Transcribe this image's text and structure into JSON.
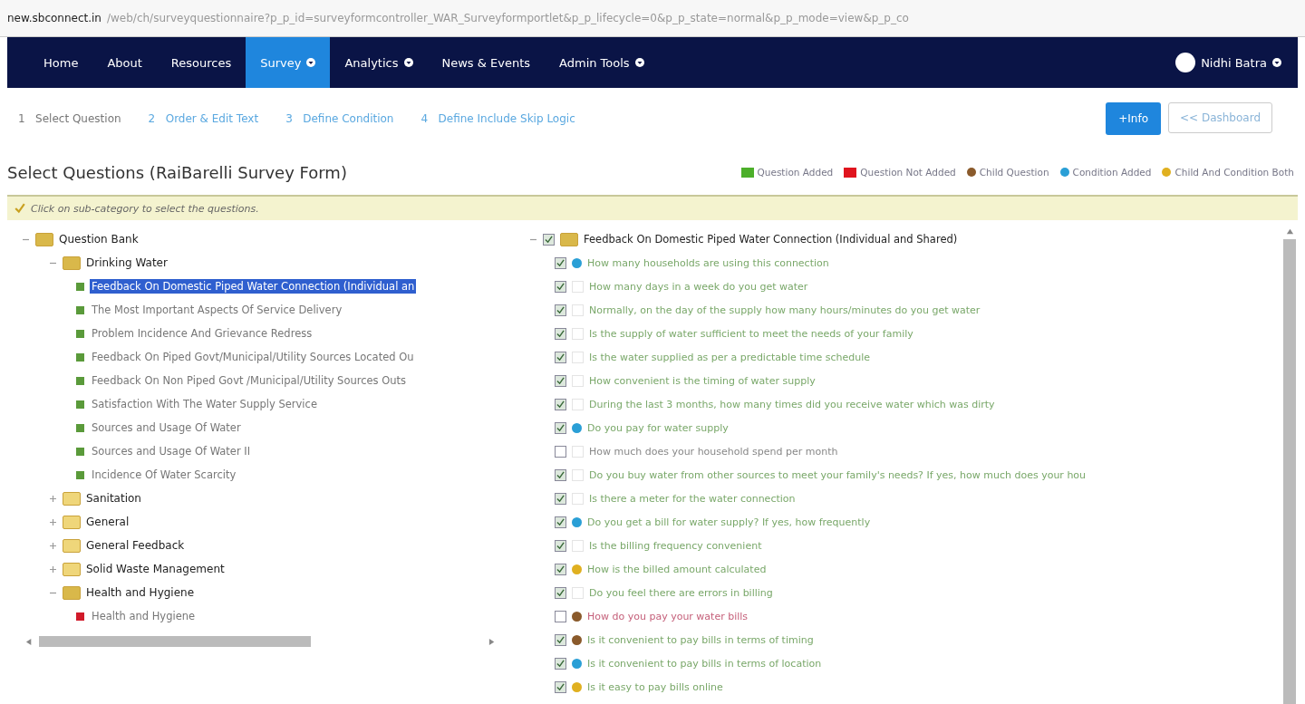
{
  "address_bar": {
    "domain": "new.sbconnect.in",
    "path": "/web/ch/surveyquestionnaire?p_p_id=surveyformcontroller_WAR_Surveyformportlet&p_p_lifecycle=0&p_p_state=normal&p_p_mode=view&p_p_co"
  },
  "nav": {
    "items": [
      {
        "label": "Home",
        "selected": false,
        "dropdown": false
      },
      {
        "label": "About",
        "selected": false,
        "dropdown": false
      },
      {
        "label": "Resources",
        "selected": false,
        "dropdown": false
      },
      {
        "label": "Survey",
        "selected": true,
        "dropdown": true
      },
      {
        "label": "Analytics",
        "selected": false,
        "dropdown": true
      },
      {
        "label": "News & Events",
        "selected": false,
        "dropdown": false
      },
      {
        "label": "Admin Tools",
        "selected": false,
        "dropdown": true
      }
    ],
    "user": "Nidhi Batra"
  },
  "steps": [
    {
      "number": "1",
      "label": "Select Question",
      "selected": true
    },
    {
      "number": "2",
      "label": "Order & Edit Text",
      "selected": false
    },
    {
      "number": "3",
      "label": "Define Condition",
      "selected": false
    },
    {
      "number": "4",
      "label": "Define Include Skip Logic",
      "selected": false
    }
  ],
  "buttons": {
    "info": "+Info",
    "dashboard": "<< Dashboard"
  },
  "title": "Select Questions (RaiBarelli Survey Form)",
  "legend": [
    {
      "kind": "square",
      "label": "Question Added",
      "color": "#4caf2a"
    },
    {
      "kind": "square",
      "label": "Question Not Added",
      "color": "#e0141e"
    },
    {
      "kind": "dot",
      "label": "Child Question",
      "color": "#8a5a2b"
    },
    {
      "kind": "dot",
      "label": "Condition Added",
      "color": "#2a9fd6"
    },
    {
      "kind": "dot",
      "label": "Child And Condition Both",
      "color": "#e0b020"
    }
  ],
  "hint": "Click on sub-category to select the questions.",
  "tree": [
    {
      "label": "Question Bank",
      "expanded": true,
      "children": [
        {
          "label": "Drinking Water",
          "expanded": true,
          "children": [
            {
              "label": "Feedback On Domestic Piped Water Connection (Individual an",
              "color": "#5a9a3a",
              "selected": true
            },
            {
              "label": "The Most Important Aspects Of Service Delivery",
              "color": "#5a9a3a",
              "selected": false
            },
            {
              "label": "Problem Incidence And Grievance Redress",
              "color": "#5a9a3a",
              "selected": false
            },
            {
              "label": "Feedback On Piped Govt/Municipal/Utility Sources Located Ou",
              "color": "#5a9a3a",
              "selected": false
            },
            {
              "label": "Feedback On Non Piped Govt /Municipal/Utility Sources Outs",
              "color": "#5a9a3a",
              "selected": false
            },
            {
              "label": "Satisfaction With The Water Supply Service",
              "color": "#5a9a3a",
              "selected": false
            },
            {
              "label": "Sources and Usage Of Water",
              "color": "#5a9a3a",
              "selected": false
            },
            {
              "label": "Sources and Usage Of Water II",
              "color": "#5a9a3a",
              "selected": false
            },
            {
              "label": "Incidence Of Water Scarcity",
              "color": "#5a9a3a",
              "selected": false
            }
          ]
        },
        {
          "label": "Sanitation",
          "expanded": false
        },
        {
          "label": "General",
          "expanded": false
        },
        {
          "label": "General Feedback",
          "expanded": false
        },
        {
          "label": "Solid Waste Management",
          "expanded": false
        },
        {
          "label": "Health and Hygiene",
          "expanded": true,
          "children": [
            {
              "label": "Health and Hygiene",
              "color": "#d11a2a",
              "selected": false
            }
          ]
        }
      ]
    }
  ],
  "questions": {
    "title": "Feedback On Domestic Piped Water Connection (Individual and Shared)",
    "expanded": true,
    "checked": true,
    "items": [
      {
        "text": "How many households are using this connection",
        "checked": true,
        "marker": {
          "color": "#2a9fd6"
        },
        "color": "#7aa86a"
      },
      {
        "text": "How many days in a week do you get water",
        "checked": true,
        "color": "#7aa86a"
      },
      {
        "text": "Normally, on the day of the supply how many hours/minutes do you get water",
        "checked": true,
        "color": "#7aa86a"
      },
      {
        "text": "Is the supply of water sufficient to meet the needs of your family",
        "checked": true,
        "color": "#7aa86a"
      },
      {
        "text": "Is the water supplied as per a predictable time schedule",
        "checked": true,
        "color": "#7aa86a"
      },
      {
        "text": "How convenient is the timing of water supply",
        "checked": true,
        "color": "#7aa86a"
      },
      {
        "text": "During the last 3 months, how many times did you receive water which was dirty",
        "checked": true,
        "color": "#7aa86a"
      },
      {
        "text": "Do you pay for water supply",
        "checked": true,
        "marker": {
          "color": "#2a9fd6"
        },
        "color": "#7aa86a"
      },
      {
        "text": "How much does your household spend per month",
        "checked": false,
        "color": "#888888"
      },
      {
        "text": "Do you buy water from other sources to meet your family's needs? If yes, how much does your hou",
        "checked": true,
        "color": "#7aa86a"
      },
      {
        "text": "Is there a meter for the water connection",
        "checked": true,
        "color": "#7aa86a"
      },
      {
        "text": "Do you get a bill for water supply? If yes, how frequently",
        "checked": true,
        "marker": {
          "color": "#2a9fd6"
        },
        "color": "#7aa86a"
      },
      {
        "text": "Is the billing frequency convenient",
        "checked": true,
        "color": "#7aa86a"
      },
      {
        "text": "How is the billed amount calculated",
        "checked": true,
        "marker": {
          "color": "#e0b020"
        },
        "color": "#7aa86a"
      },
      {
        "text": "Do you feel there are errors in billing",
        "checked": true,
        "color": "#7aa86a"
      },
      {
        "text": "How do you pay your water bills",
        "checked": false,
        "marker": {
          "color": "#8a5a2b"
        },
        "color": "#c5607a"
      },
      {
        "text": "Is it convenient to pay bills in terms of timing",
        "checked": true,
        "marker": {
          "color": "#8a5a2b"
        },
        "color": "#7aa86a"
      },
      {
        "text": "Is it convenient to pay bills in terms of location",
        "checked": true,
        "marker": {
          "color": "#2a9fd6"
        },
        "color": "#7aa86a"
      },
      {
        "text": "Is it easy to pay bills online",
        "checked": true,
        "marker": {
          "color": "#e0b020"
        },
        "color": "#7aa86a"
      }
    ]
  }
}
